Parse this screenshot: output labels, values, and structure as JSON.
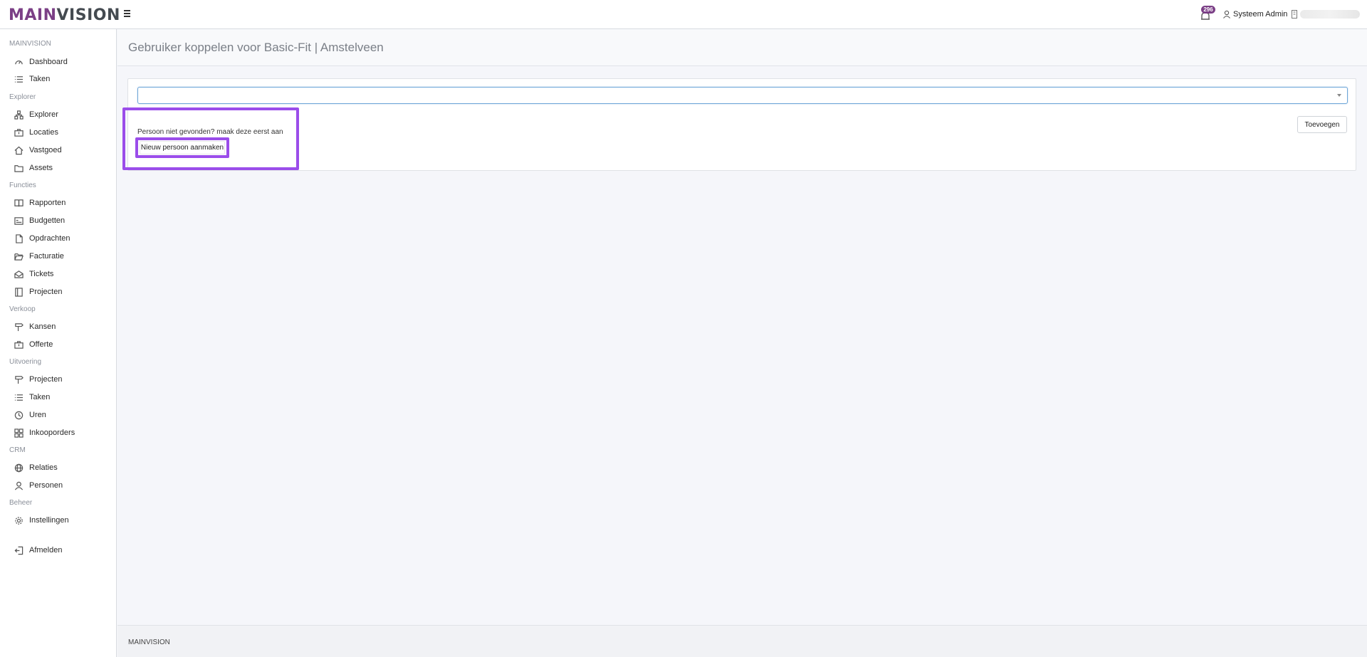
{
  "header": {
    "logo_main": "MAIN",
    "logo_vision": "VISION",
    "notification_count": "296",
    "user_name": "Systeem Admin"
  },
  "sidebar": {
    "sections": [
      {
        "title": "MAINVISION",
        "items": [
          {
            "label": "Dashboard",
            "icon": "gauge-icon"
          },
          {
            "label": "Taken",
            "icon": "list-icon"
          }
        ]
      },
      {
        "title": "Explorer",
        "items": [
          {
            "label": "Explorer",
            "icon": "hierarchy-icon"
          },
          {
            "label": "Locaties",
            "icon": "briefcase-icon"
          },
          {
            "label": "Vastgoed",
            "icon": "home-icon"
          },
          {
            "label": "Assets",
            "icon": "folder-icon"
          }
        ]
      },
      {
        "title": "Functies",
        "items": [
          {
            "label": "Rapporten",
            "icon": "book-icon"
          },
          {
            "label": "Budgetten",
            "icon": "budget-icon"
          },
          {
            "label": "Opdrachten",
            "icon": "file-icon"
          },
          {
            "label": "Facturatie",
            "icon": "folder-open-icon"
          },
          {
            "label": "Tickets",
            "icon": "envelope-open-icon"
          },
          {
            "label": "Projecten",
            "icon": "book-open-icon"
          }
        ]
      },
      {
        "title": "Verkoop",
        "items": [
          {
            "label": "Kansen",
            "icon": "signpost-icon"
          },
          {
            "label": "Offerte",
            "icon": "briefcase-icon"
          }
        ]
      },
      {
        "title": "Uitvoering",
        "items": [
          {
            "label": "Projecten",
            "icon": "signpost-icon"
          },
          {
            "label": "Taken",
            "icon": "list-icon"
          },
          {
            "label": "Uren",
            "icon": "clock-icon"
          },
          {
            "label": "Inkooporders",
            "icon": "grid-icon"
          }
        ]
      },
      {
        "title": "CRM",
        "items": [
          {
            "label": "Relaties",
            "icon": "globe-icon"
          },
          {
            "label": "Personen",
            "icon": "person-icon"
          }
        ]
      },
      {
        "title": "Beheer",
        "items": [
          {
            "label": "Instellingen",
            "icon": "gear-icon"
          }
        ]
      }
    ],
    "logout": {
      "label": "Afmelden",
      "icon": "logout-icon"
    }
  },
  "page": {
    "title": "Gebruiker koppelen voor Basic-Fit | Amstelveen",
    "select_value": "",
    "add_button": "Toevoegen",
    "hint_text": "Persoon niet gevonden? maak deze eerst aan",
    "new_person_button": "Nieuw persoon aanmaken"
  },
  "footer": {
    "text": "MAINVISION"
  },
  "colors": {
    "brand": "#7b3f86",
    "highlight": "#9b4dea",
    "focus": "#6ea6d8"
  }
}
